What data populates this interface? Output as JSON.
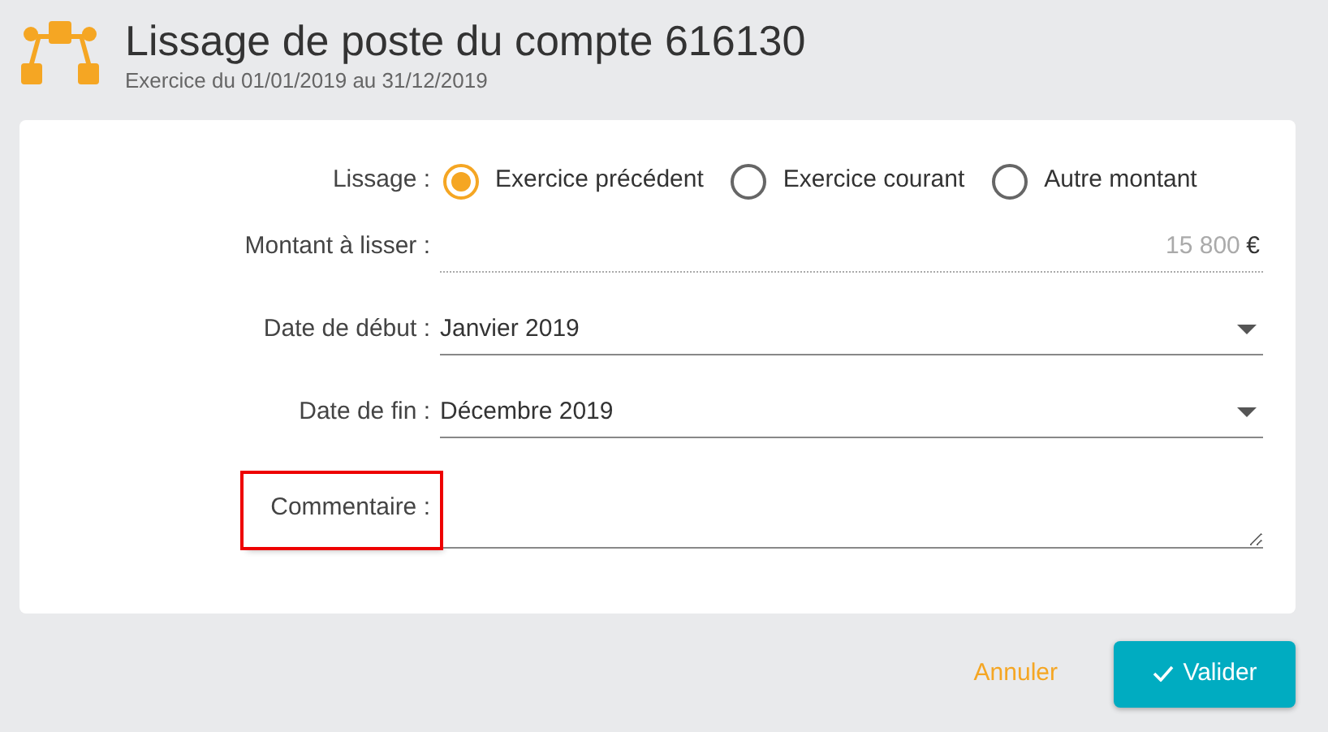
{
  "header": {
    "title": "Lissage de poste du compte 616130",
    "subtitle": "Exercice du 01/01/2019 au 31/12/2019"
  },
  "form": {
    "lissage": {
      "label": "Lissage :",
      "options": [
        {
          "label": "Exercice précédent",
          "selected": true
        },
        {
          "label": "Exercice courant",
          "selected": false
        },
        {
          "label": "Autre montant",
          "selected": false
        }
      ]
    },
    "amount": {
      "label": "Montant à lisser :",
      "value": "15 800",
      "currency": "€"
    },
    "selects": [
      {
        "label": "Date de début :",
        "value": "Janvier 2019"
      },
      {
        "label": "Date de fin :",
        "value": "Décembre 2019"
      }
    ],
    "comment": {
      "label": "Commentaire :",
      "highlighted": true
    }
  },
  "buttons": [
    {
      "label": "Annuler",
      "kind": "text"
    },
    {
      "label": "Valider",
      "kind": "primary"
    }
  ]
}
